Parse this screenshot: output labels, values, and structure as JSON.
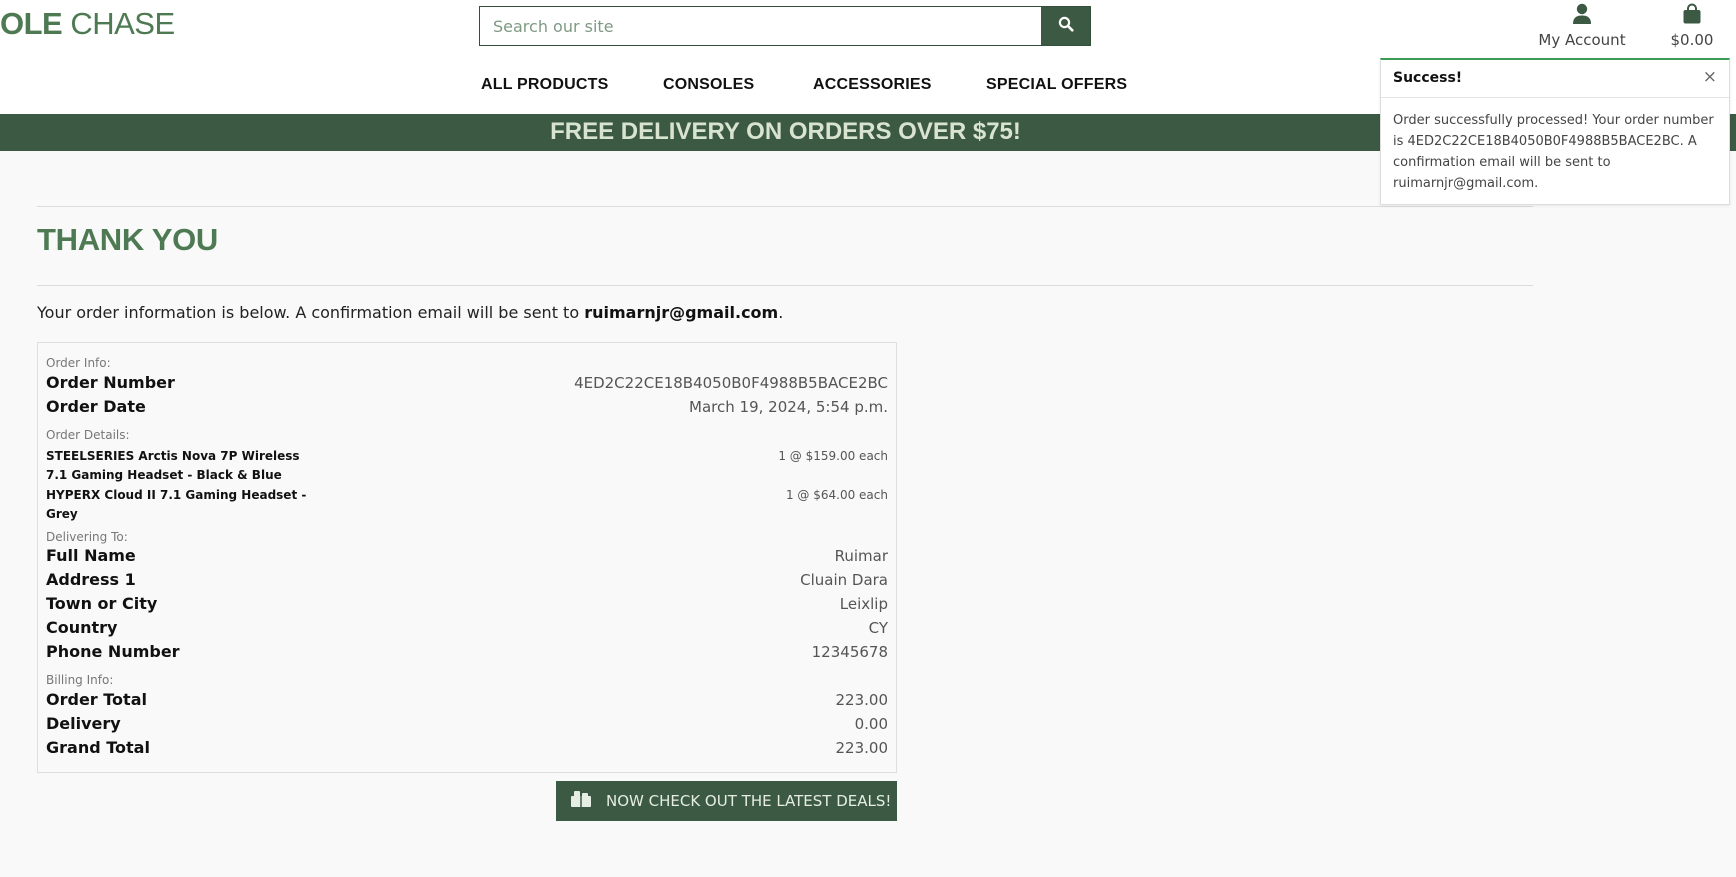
{
  "header": {
    "logo_bold": "OLE",
    "logo_light": " CHASE",
    "search_placeholder": "Search our site",
    "account_label": "My Account",
    "cart_total": "$0.00"
  },
  "nav": {
    "items": [
      "ALL PRODUCTS",
      "CONSOLES",
      "ACCESSORIES",
      "SPECIAL OFFERS"
    ]
  },
  "banner": "FREE DELIVERY ON ORDERS OVER $75!",
  "page": {
    "title": "THANK YOU",
    "intro_prefix": "Your order information is below. A confirmation email will be sent to ",
    "email": "ruimarnjr@gmail.com",
    "intro_suffix": "."
  },
  "order": {
    "order_info_label": "Order Info:",
    "order_number_label": "Order Number",
    "order_number": "4ED2C22CE18B4050B0F4988B5BACE2BC",
    "order_date_label": "Order Date",
    "order_date": "March 19, 2024, 5:54 p.m.",
    "details_label": "Order Details:",
    "items": [
      {
        "name": "STEELSERIES Arctis Nova 7P Wireless 7.1 Gaming Headset - Black & Blue",
        "qty": "1 @ $159.00 each"
      },
      {
        "name": "HYPERX Cloud II 7.1 Gaming Headset - Grey",
        "qty": "1 @ $64.00 each"
      }
    ],
    "delivering_label": "Delivering To:",
    "full_name_label": "Full Name",
    "full_name": "Ruimar",
    "address1_label": "Address 1",
    "address1": "Cluain Dara",
    "town_label": "Town or City",
    "town": "Leixlip",
    "country_label": "Country",
    "country": "CY",
    "phone_label": "Phone Number",
    "phone": "12345678",
    "billing_label": "Billing Info:",
    "order_total_label": "Order Total",
    "order_total": "223.00",
    "delivery_label": "Delivery",
    "delivery": "0.00",
    "grand_total_label": "Grand Total",
    "grand_total": "223.00"
  },
  "cta": "NOW CHECK OUT THE LATEST DEALS!",
  "toast": {
    "title": "Success!",
    "close": "×",
    "message": "Order successfully processed! Your order number is 4ED2C22CE18B4050B0F4988B5BACE2BC. A confirmation email will be sent to ruimarnjr@gmail.com."
  },
  "colors": {
    "brand_green": "#3b5943",
    "logo_green": "#4e7a53",
    "success_border": "#3b9a54"
  },
  "icons": [
    "search-icon",
    "user-icon",
    "shopping-bag-icon",
    "close-icon",
    "deals-icon"
  ]
}
